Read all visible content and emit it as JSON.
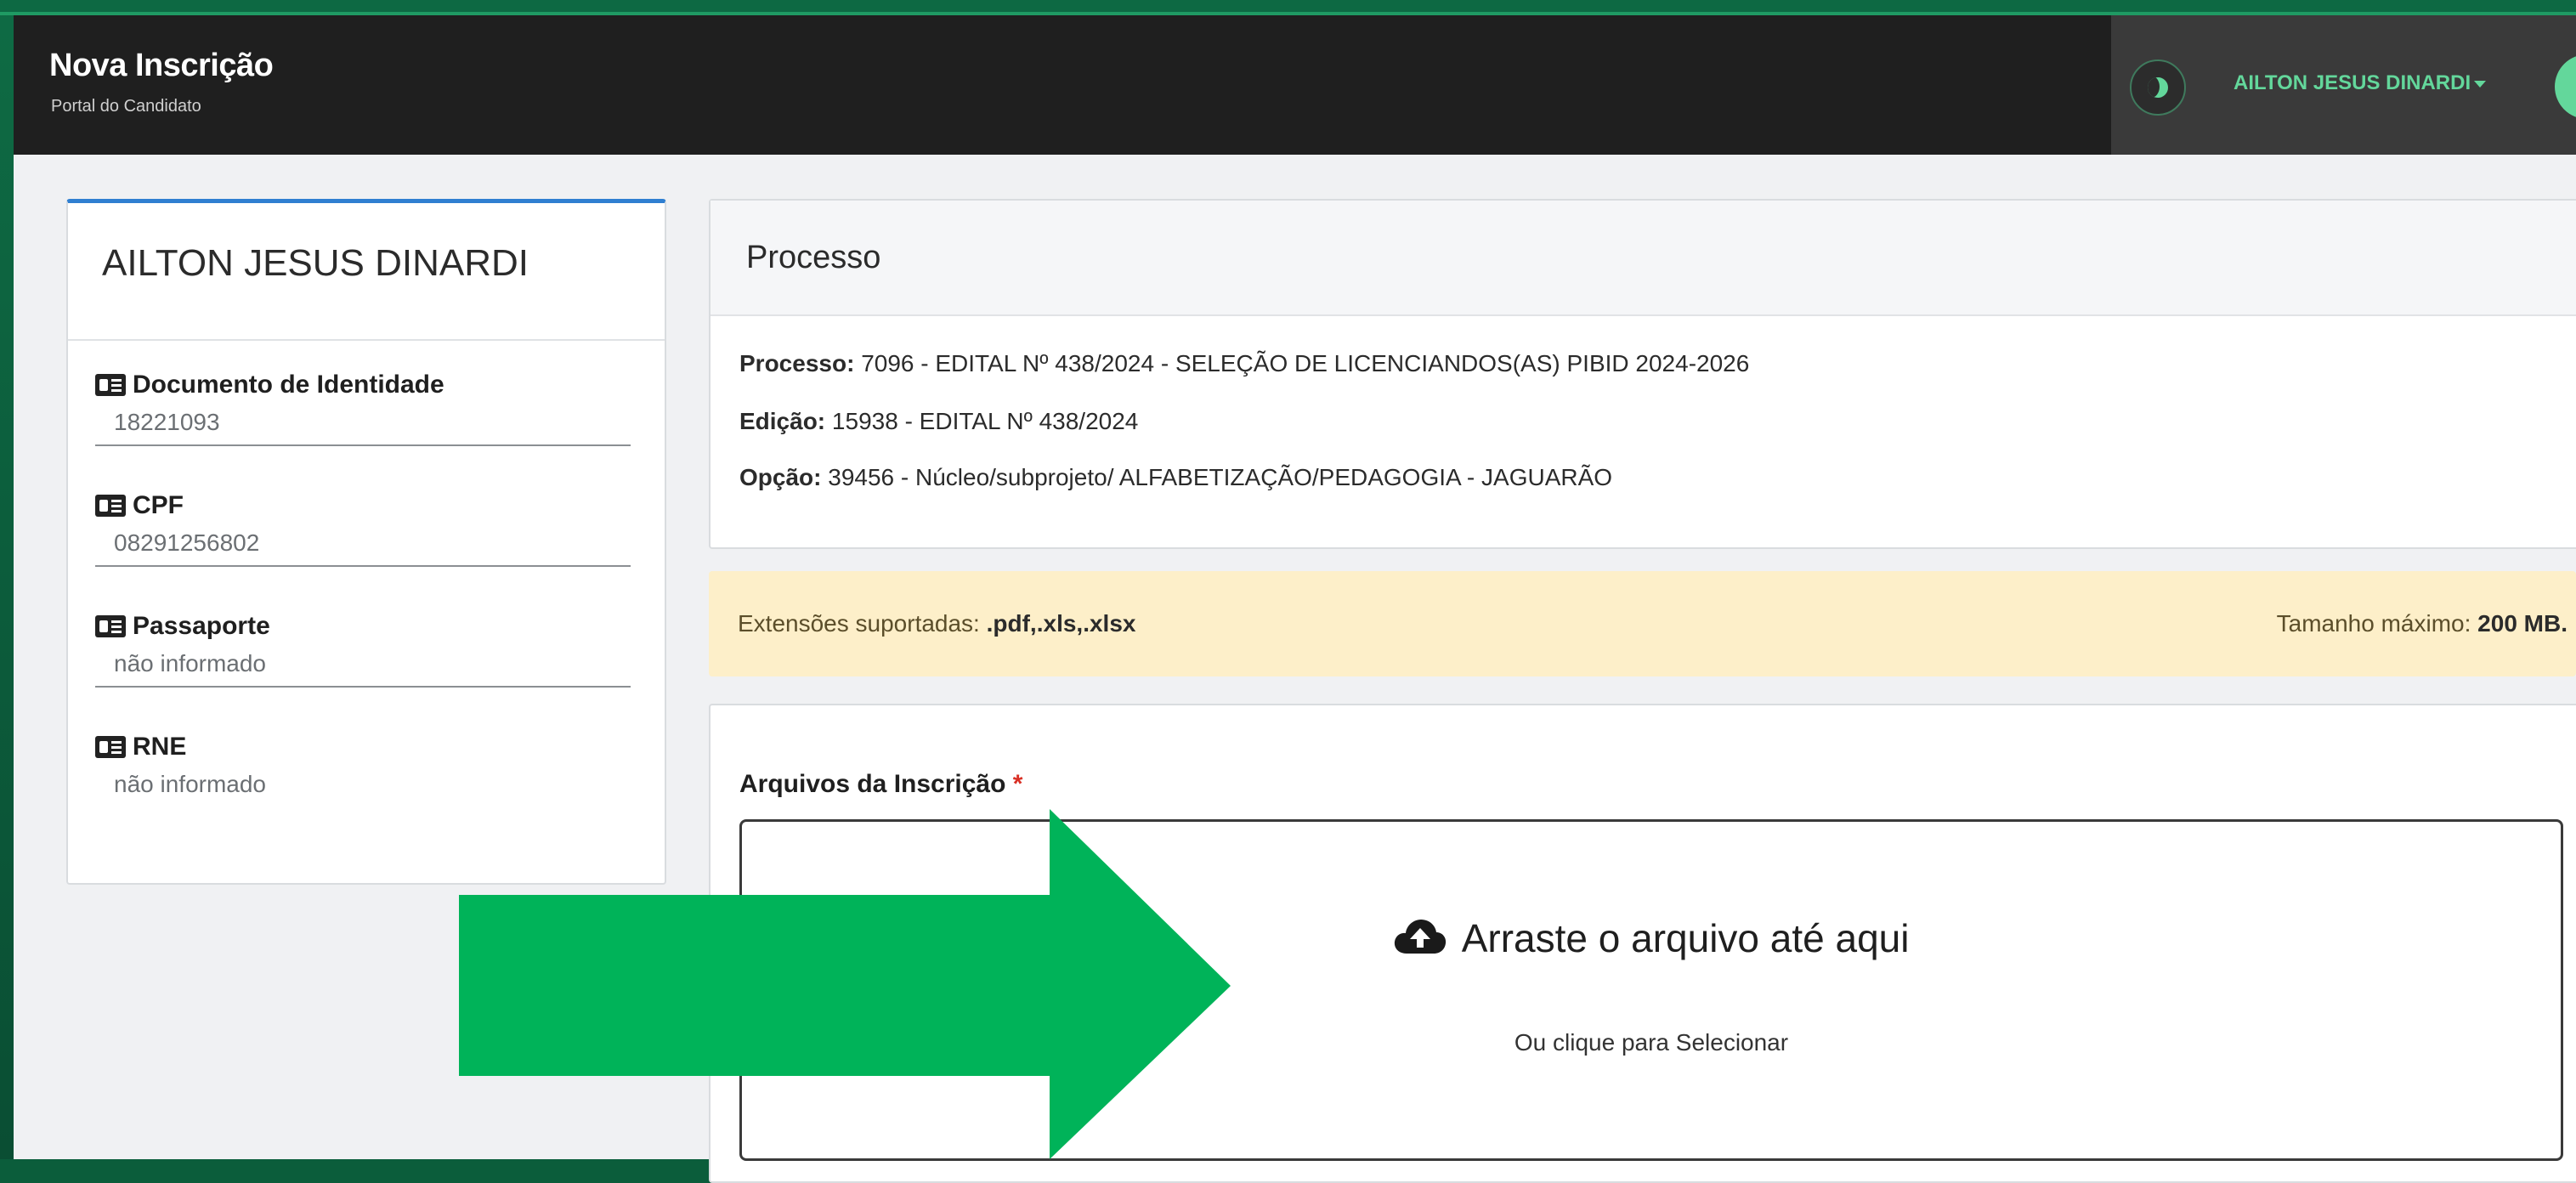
{
  "header": {
    "title": "Nova Inscrição",
    "subtitle": "Portal do Candidato",
    "user_name": "AILTON JESUS DINARDI"
  },
  "profile": {
    "name": "AILTON JESUS DINARDI",
    "fields": [
      {
        "label": "Documento de Identidade",
        "value": "18221093",
        "icon": "id-card-icon"
      },
      {
        "label": "CPF",
        "value": "08291256802",
        "icon": "id-card-icon"
      },
      {
        "label": "Passaporte",
        "value": "não informado",
        "icon": "id-card-icon"
      },
      {
        "label": "RNE",
        "value": "não informado",
        "icon": "id-card-icon"
      }
    ]
  },
  "process": {
    "title": "Processo",
    "lines": [
      {
        "label": "Processo:",
        "value": "7096 - EDITAL Nº 438/2024 - SELEÇÃO DE LICENCIANDOS(AS) PIBID 2024-2026"
      },
      {
        "label": "Edição:",
        "value": "15938 - EDITAL Nº 438/2024"
      },
      {
        "label": "Opção:",
        "value": "39456 - Núcleo/subprojeto/ ALFABETIZAÇÃO/PEDAGOGIA - JAGUARÃO"
      }
    ]
  },
  "notice": {
    "extensions_label": "Extensões suportadas:",
    "extensions_value": ".pdf,.xls,.xlsx",
    "size_label": "Tamanho máximo:",
    "size_value": "200 MB."
  },
  "files": {
    "label": "Arquivos da Inscrição",
    "required_mark": "*",
    "drop_title": "Arraste o arquivo até aqui",
    "drop_subtitle": "Ou clique para Selecionar"
  },
  "colors": {
    "navbar": "#1f1f1f",
    "accent_green": "#63d79b",
    "arrow_green": "#00b359",
    "notice_bg": "#fdefc9",
    "card_top_border": "#2f7fd1"
  }
}
